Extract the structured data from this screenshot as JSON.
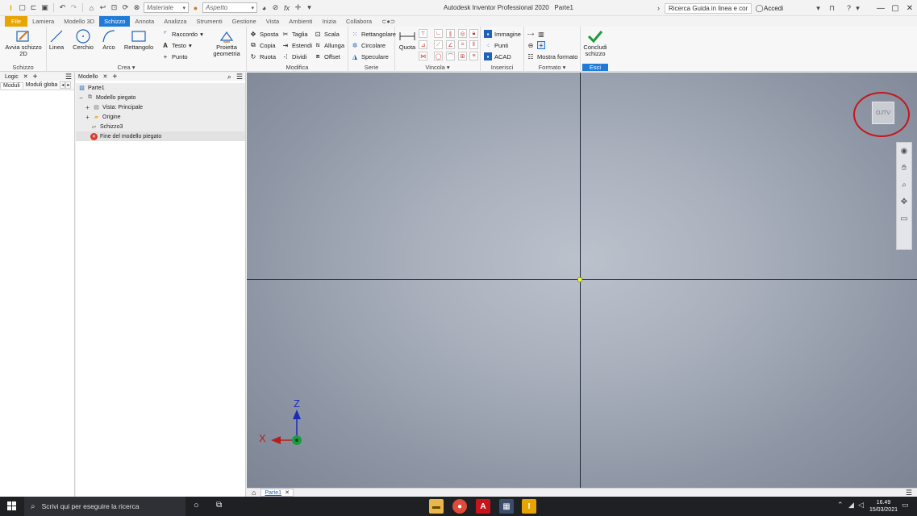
{
  "window": {
    "title": "Autodesk Inventor Professional 2020",
    "document": "Parte1",
    "help_search": "Ricerca Guida in linea e comandi",
    "account": "Accedi"
  },
  "qat": {
    "material": "Materiale",
    "appearance": "Aspetto"
  },
  "tabs": [
    {
      "label": "File"
    },
    {
      "label": "Lamiera"
    },
    {
      "label": "Modello 3D"
    },
    {
      "label": "Schizzo"
    },
    {
      "label": "Annota"
    },
    {
      "label": "Analizza"
    },
    {
      "label": "Strumenti"
    },
    {
      "label": "Gestione"
    },
    {
      "label": "Vista"
    },
    {
      "label": "Ambienti"
    },
    {
      "label": "Inizia"
    },
    {
      "label": "Collabora"
    }
  ],
  "ribbon": {
    "schizzo": {
      "start_label": "Avvia schizzo 2D",
      "panel": "Schizzo"
    },
    "crea": {
      "panel": "Crea",
      "linea": "Linea",
      "cerchio": "Cerchio",
      "arco": "Arco",
      "rettangolo": "Rettangolo",
      "raccordo": "Raccordo",
      "testo": "Testo",
      "punto": "Punto",
      "proietta": "Proietta geometria"
    },
    "modifica": {
      "panel": "Modifica",
      "sposta": "Sposta",
      "copia": "Copia",
      "ruota": "Ruota",
      "taglia": "Taglia",
      "estendi": "Estendi",
      "dividi": "Dividi",
      "scala": "Scala",
      "allunga": "Allunga",
      "offset": "Offset"
    },
    "serie": {
      "panel": "Serie",
      "rettangolare": "Rettangolare",
      "circolare": "Circolare",
      "speculare": "Speculare"
    },
    "vincola": {
      "panel": "Vincola",
      "quota": "Quota"
    },
    "inserisci": {
      "panel": "Inserisci",
      "immagine": "Immagine",
      "punti": "Punti",
      "acad": "ACAD"
    },
    "formato": {
      "panel": "Formato",
      "mostra": "Mostra formato"
    },
    "esci": {
      "panel": "Esci",
      "concludi": "Concludi schizzo"
    }
  },
  "left_panel": {
    "tab": "Logic",
    "subtabs": [
      "Moduli",
      "Moduli globa"
    ]
  },
  "tree_panel": {
    "tab": "Modello",
    "items": [
      {
        "label": "Parte1"
      },
      {
        "label": "Modello piegato"
      },
      {
        "label": "Vista: Principale"
      },
      {
        "label": "Origine"
      },
      {
        "label": "Schizzo3"
      },
      {
        "label": "Fine del modello piegato"
      }
    ]
  },
  "canvas": {
    "viewcube_label": "OJTV",
    "axis_z": "Z",
    "axis_x": "X"
  },
  "doc_tab": "Parte1",
  "taskbar": {
    "search": "Scrivi qui per eseguire la ricerca",
    "time": "16.49",
    "date": "15/03/2021"
  },
  "colors": {
    "accent": "#1f7bd6",
    "file_tab": "#e8a400",
    "check_green": "#1e9b3e",
    "annotation_red": "#c8151b"
  }
}
